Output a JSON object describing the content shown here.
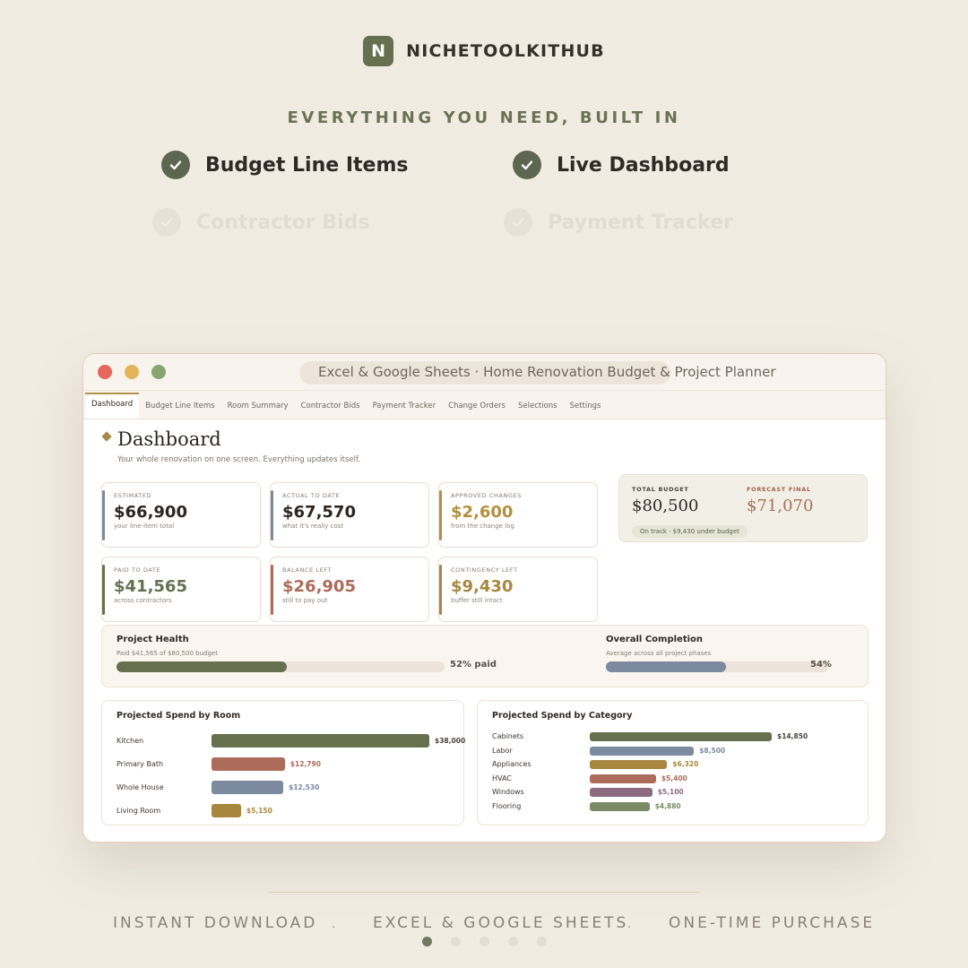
{
  "brand": {
    "mark": "N",
    "name": "NICHETOOLKITHUB"
  },
  "tagline": "EVERYTHING YOU NEED, BUILT IN",
  "features": [
    "Budget Line Items",
    "Live Dashboard",
    "Contractor Bids",
    "Payment Tracker"
  ],
  "window": {
    "title": "Excel & Google Sheets  ·  Home Renovation Budget & Project Planner",
    "tabs": [
      "Dashboard",
      "Budget Line Items",
      "Room Summary",
      "Contractor Bids",
      "Payment Tracker",
      "Change Orders",
      "Selections",
      "Settings"
    ],
    "active_tab": "Dashboard"
  },
  "dashboard": {
    "title": "Dashboard",
    "subtitle": "Your whole renovation on one screen. Everything updates itself.",
    "stats": [
      {
        "label": "ESTIMATED",
        "value": "$66,900",
        "sub": "your line-item total",
        "color": "#7c8aa0"
      },
      {
        "label": "ACTUAL TO DATE",
        "value": "$67,570",
        "sub": "what it's really cost",
        "color": "#7c8aa0"
      },
      {
        "label": "APPROVED CHANGES",
        "value": "$2,600",
        "sub": "from the change log",
        "color": "#b3903f"
      },
      {
        "label": "PAID TO DATE",
        "value": "$41,565",
        "sub": "across contractors",
        "color": "#66704f"
      },
      {
        "label": "BALANCE LEFT",
        "value": "$26,905",
        "sub": "still to pay out",
        "color": "#ad6b5a"
      },
      {
        "label": "CONTINGENCY LEFT",
        "value": "$9,430",
        "sub": "buffer still intact",
        "color": "#a7873e"
      }
    ],
    "budget": {
      "total_label": "TOTAL BUDGET",
      "total_value": "$80,500",
      "forecast_label": "FORECAST FINAL",
      "forecast_value": "$71,070",
      "status": "On track · $9,430 under budget"
    },
    "health": {
      "title": "Project Health",
      "sub": "Paid $41,565 of $80,500 budget",
      "pct_text": "52% paid",
      "pct": 0.52,
      "completion_title": "Overall Completion",
      "completion_sub": "Average across all project phases",
      "completion_pct_text": "54%",
      "completion_pct": 0.54
    }
  },
  "chart_data": [
    {
      "type": "bar",
      "title": "Projected Spend by Room",
      "categories": [
        "Kitchen",
        "Primary Bath",
        "Whole House",
        "Living Room"
      ],
      "values": [
        38000,
        12790,
        12530,
        5150
      ],
      "labels": [
        "$38,000",
        "$12,790",
        "$12,530",
        "$5,150"
      ],
      "colors": [
        "#66704f",
        "#ad6b5a",
        "#7c8aa0",
        "#a7873e"
      ]
    },
    {
      "type": "bar",
      "title": "Projected Spend by Category",
      "categories": [
        "Cabinets",
        "Labor",
        "Appliances",
        "HVAC",
        "Windows",
        "Flooring"
      ],
      "values": [
        14850,
        8500,
        6320,
        5400,
        5100,
        4880
      ],
      "labels": [
        "$14,850",
        "$8,500",
        "$6,320",
        "$5,400",
        "$5,100",
        "$4,880"
      ],
      "colors": [
        "#66704f",
        "#7c8aa0",
        "#a7873e",
        "#ad6b5a",
        "#8c6b80",
        "#7a8a64"
      ]
    }
  ],
  "footer": {
    "items": [
      "INSTANT DOWNLOAD",
      "EXCEL & GOOGLE SHEETS",
      "ONE-TIME PURCHASE"
    ],
    "separator": "·"
  },
  "pager": {
    "active": 0,
    "count": 5
  }
}
